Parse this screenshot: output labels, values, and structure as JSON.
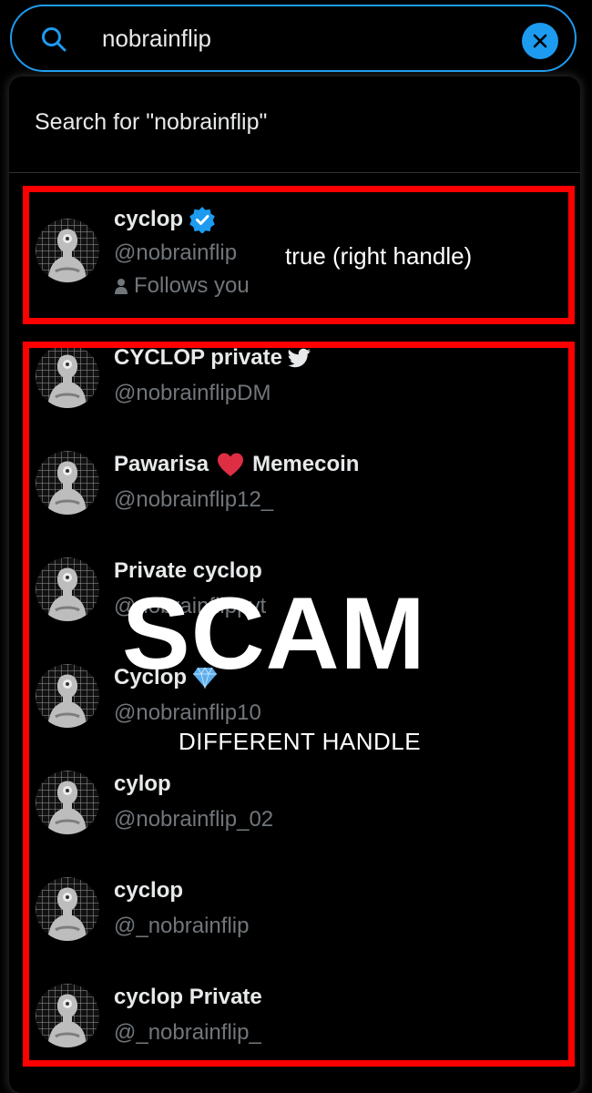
{
  "search": {
    "value": "nobrainflip"
  },
  "dropdown": {
    "search_for": "Search for \"nobrainflip\""
  },
  "results": [
    {
      "name": "cyclop",
      "handle": "@nobrainflip",
      "follows": "Follows you",
      "badge": "verified"
    },
    {
      "name": "CYCLOP private",
      "handle": "@nobrainflipDM",
      "emoji": "twitter-bird"
    },
    {
      "name": "Pawarisa",
      "name_suffix": "Memecoin",
      "handle": "@nobrainflip12_",
      "emoji": "red-heart"
    },
    {
      "name": "Private cyclop",
      "handle": "@nobrainflippvt"
    },
    {
      "name": "Cyclop",
      "handle": "@nobrainflip10",
      "emoji": "gem"
    },
    {
      "name": "cylop",
      "handle": "@nobrainflip_02"
    },
    {
      "name": "cyclop",
      "handle": "@_nobrainflip"
    },
    {
      "name": "cyclop Private",
      "handle": "@_nobrainflip_"
    }
  ],
  "annotations": {
    "true_label": "true (right handle)",
    "scam_label": "SCAM",
    "different_label": "DIFFERENT HANDLE"
  },
  "colors": {
    "accent": "#1d9bf0",
    "highlight": "#ff0000",
    "muted": "#71767b"
  }
}
